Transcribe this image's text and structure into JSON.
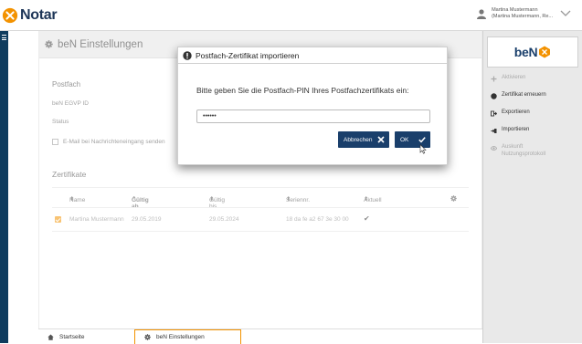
{
  "app": {
    "name": "Notar"
  },
  "user": {
    "name": "Martina Mustermann",
    "detail": "(Martina Mustermann, Re..."
  },
  "main": {
    "title": "beN Einstellungen",
    "postfach": {
      "heading": "Postfach",
      "egvp_label": "beN EGVP ID",
      "status_label": "Status",
      "email_label": "E-Mail bei Nachrichteneingang senden"
    },
    "certificates": {
      "heading": "Zertifikate",
      "columns": [
        "Name",
        "Gültig ab",
        "Gültig bis",
        "Seriennr.",
        "Aktuell"
      ],
      "rows": [
        {
          "name": "Martina Mustermann",
          "valid_from": "29.05.2019",
          "valid_to": "29.05.2024",
          "serial": "18 da fe a2 67 3e 30 00",
          "current": "✔"
        }
      ]
    }
  },
  "dialog": {
    "title": "Postfach-Zertifikat importieren",
    "message": "Bitte geben Sie die Postfach-PIN Ihres Postfachzertifikats ein:",
    "pin_value": "······",
    "cancel_label": "Abbrechen",
    "ok_label": "OK"
  },
  "side_panel": {
    "logo": "beN",
    "actions": [
      {
        "label": "Aktivieren",
        "enabled": false
      },
      {
        "label": "Zertifikat erneuern",
        "enabled": true
      },
      {
        "label": "Exportieren",
        "enabled": true
      },
      {
        "label": "Importieren",
        "enabled": true
      },
      {
        "label": "Auskunft Nutzungsprotokoll",
        "enabled": false
      }
    ]
  },
  "tabs": [
    {
      "label": "Startseite"
    },
    {
      "label": "beN Einstellungen"
    }
  ],
  "colors": {
    "brand_navy": "#1a3f6b",
    "accent_orange": "#f39200",
    "sidebar": "#0f3c5e"
  }
}
